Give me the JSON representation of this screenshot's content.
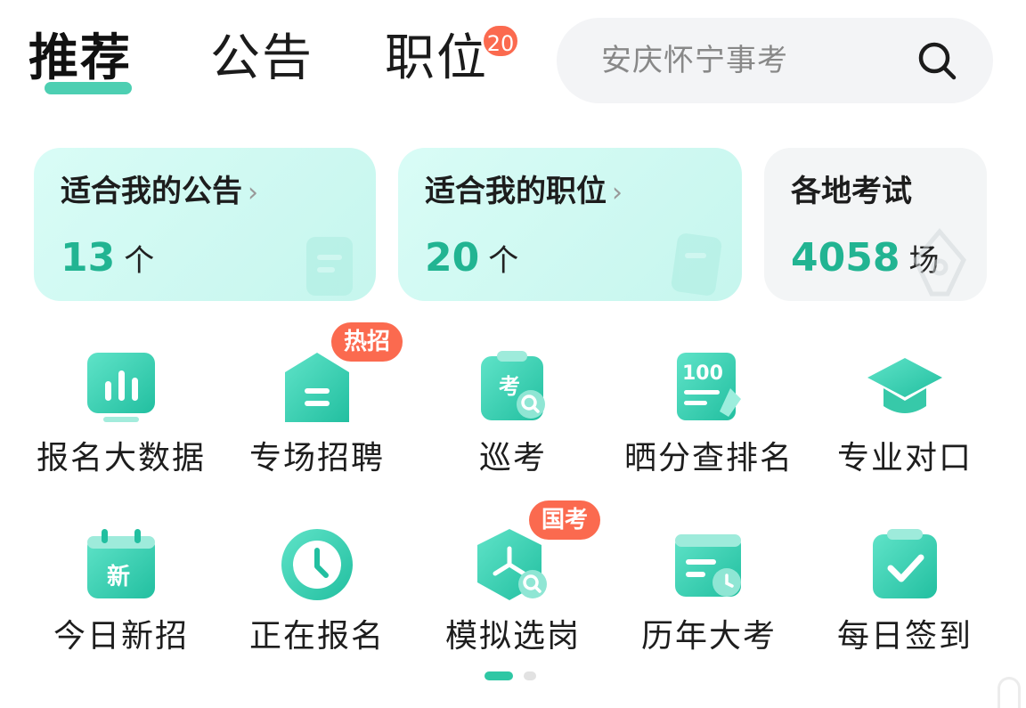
{
  "tabs": {
    "recommend": "推荐",
    "announcements": "公告",
    "positions": "职位",
    "positions_badge": "20"
  },
  "search": {
    "placeholder": "安庆怀宁事考",
    "icon": "search-icon"
  },
  "cards": [
    {
      "title": "适合我的公告",
      "arrow": "›",
      "count": "13",
      "unit": "个"
    },
    {
      "title": "适合我的职位",
      "arrow": "›",
      "count": "20",
      "unit": "个"
    },
    {
      "title": "各地考试",
      "count": "4058",
      "unit": "场"
    }
  ],
  "grid": [
    {
      "label": "报名大数据",
      "icon": "bar-chart-icon"
    },
    {
      "label": "专场招聘",
      "icon": "house-icon",
      "badge": "热招"
    },
    {
      "label": "巡考",
      "icon": "exam-search-icon"
    },
    {
      "label": "晒分查排名",
      "icon": "score-100-icon"
    },
    {
      "label": "专业对口",
      "icon": "graduation-cap-icon"
    },
    {
      "label": "今日新招",
      "icon": "calendar-new-icon"
    },
    {
      "label": "正在报名",
      "icon": "clock-icon"
    },
    {
      "label": "模拟选岗",
      "icon": "hexagon-search-icon",
      "badge": "国考"
    },
    {
      "label": "历年大考",
      "icon": "calendar-clock-icon"
    },
    {
      "label": "每日签到",
      "icon": "checkin-icon"
    }
  ],
  "colors": {
    "accent": "#2ec7a4",
    "count": "#22b492",
    "badge": "#fb6a4f",
    "card_bg": "#d9fcf6"
  },
  "pager": {
    "current": 1,
    "total": 2
  }
}
